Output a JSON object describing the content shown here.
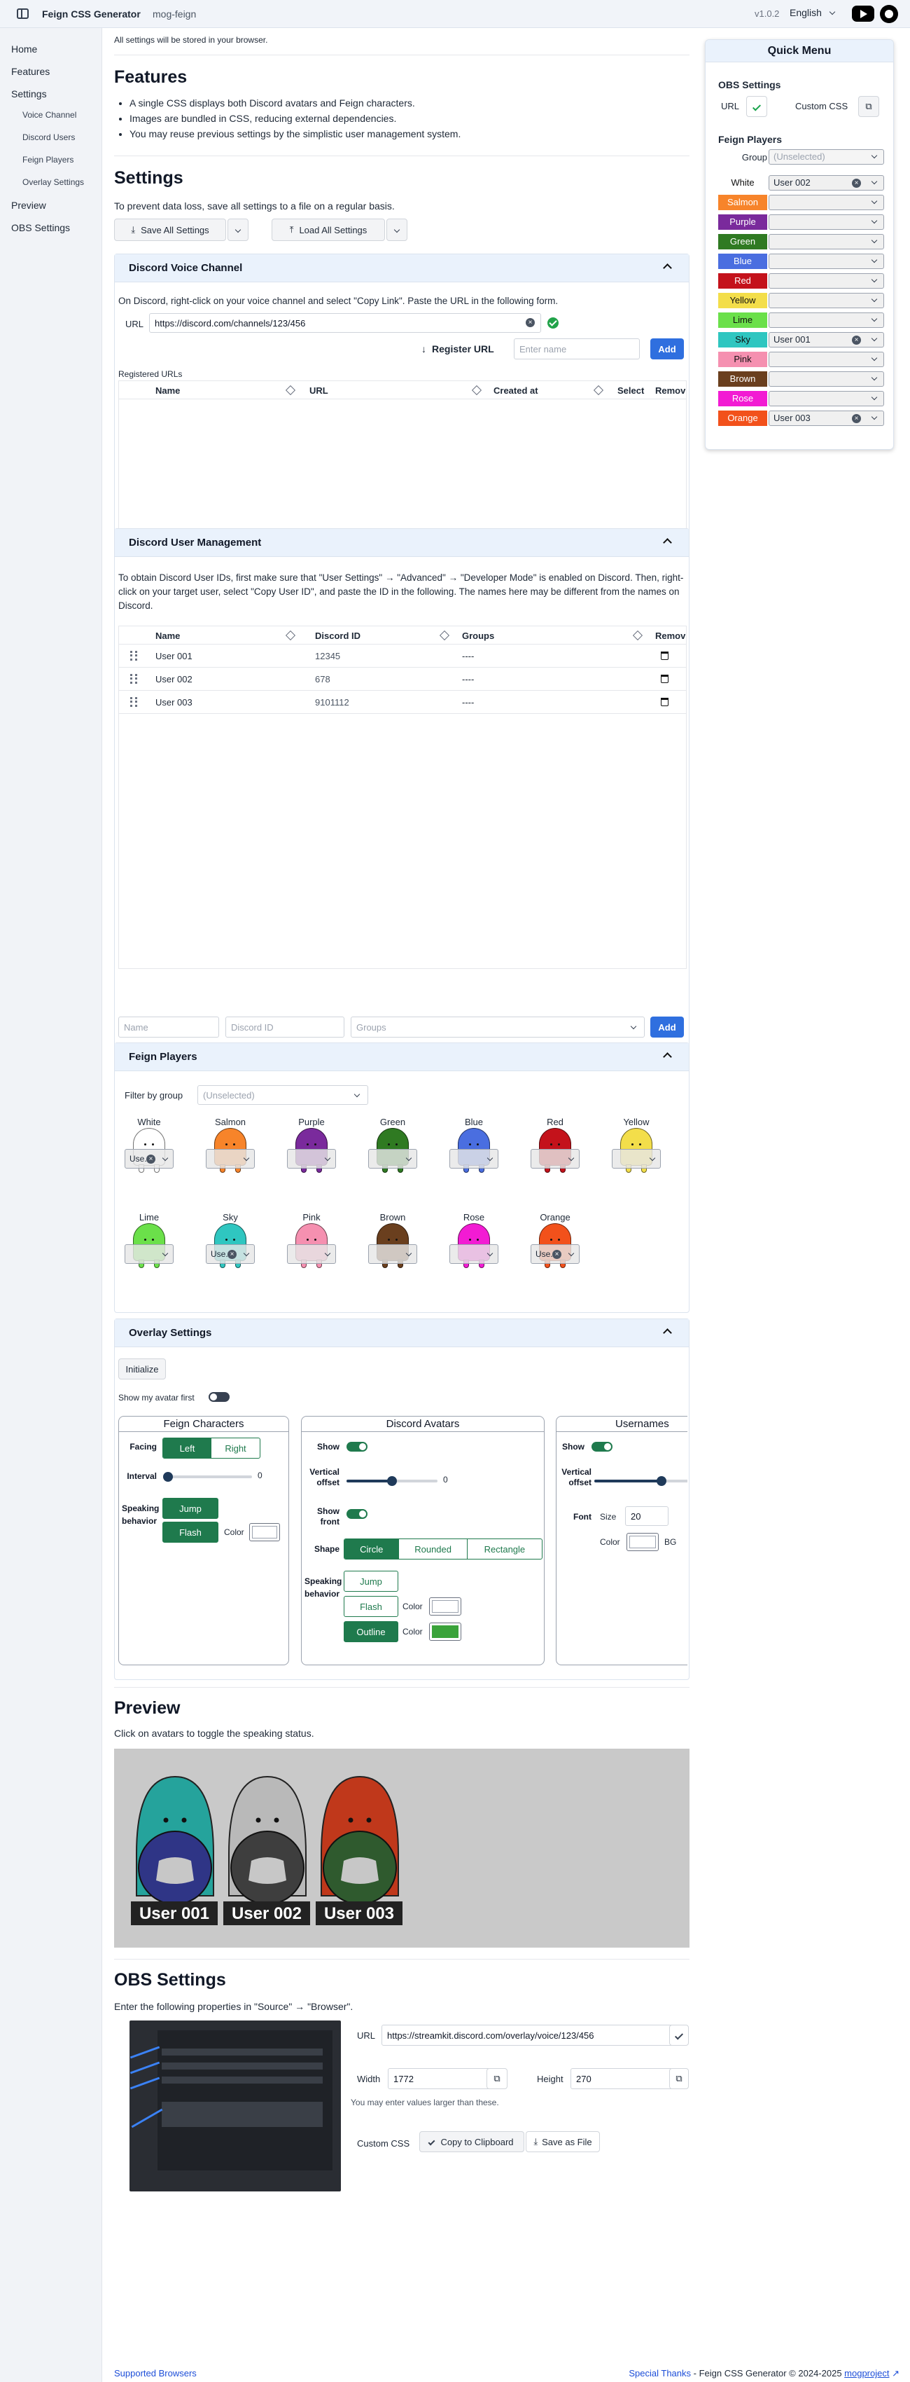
{
  "app": {
    "title": "Feign CSS Generator",
    "subtitle": "mog-feign",
    "version": "v1.0.2",
    "language": "English"
  },
  "sidebar": {
    "items": [
      {
        "label": "Home"
      },
      {
        "label": "Features"
      },
      {
        "label": "Settings"
      },
      {
        "label": "Voice Channel"
      },
      {
        "label": "Discord Users"
      },
      {
        "label": "Feign Players"
      },
      {
        "label": "Overlay Settings"
      },
      {
        "label": "Preview"
      },
      {
        "label": "OBS Settings"
      }
    ]
  },
  "notice": "All settings will be stored in your browser.",
  "features": {
    "heading": "Features",
    "bullets": [
      "A single CSS displays both Discord avatars and Feign characters.",
      "Images are bundled in CSS, reducing external dependencies.",
      "You may reuse previous settings by the simplistic user management system."
    ]
  },
  "settings": {
    "heading": "Settings",
    "desc": "To prevent data loss, save all settings to a file on a regular basis.",
    "save_all": "Save All Settings",
    "load_all": "Load All Settings"
  },
  "voice": {
    "title": "Discord Voice Channel",
    "desc": "On Discord, right-click on your voice channel and select \"Copy Link\". Paste the URL in the following form.",
    "url_label": "URL",
    "url_value": "https://discord.com/channels/123/456",
    "register": "Register URL",
    "name_placeholder": "Enter name",
    "add": "Add",
    "registered_label": "Registered URLs",
    "cols": [
      "Name",
      "URL",
      "Created at",
      "Select",
      "Remov"
    ]
  },
  "users": {
    "title": "Discord User Management",
    "desc": "To obtain Discord User IDs, first make sure that \"User Settings\" → \"Advanced\" → \"Developer Mode\" is enabled on Discord. Then, right-click on your target user, select \"Copy User ID\", and paste the ID in the following. The names here may be different from the names on Discord.",
    "cols": [
      "Name",
      "Discord ID",
      "Groups",
      "Remov"
    ],
    "rows": [
      {
        "name": "User 001",
        "id": "12345",
        "groups": "----"
      },
      {
        "name": "User 002",
        "id": "678",
        "groups": "----"
      },
      {
        "name": "User 003",
        "id": "9101112",
        "groups": "----"
      }
    ],
    "name_ph": "Name",
    "id_ph": "Discord ID",
    "groups_ph": "Groups",
    "add": "Add"
  },
  "players": {
    "title": "Feign Players",
    "filter_label": "Filter by group",
    "filter_value": "(Unselected)",
    "chars": [
      {
        "name": "White",
        "color": "#ffffff",
        "user": "Use..."
      },
      {
        "name": "Salmon",
        "color": "#f7842a",
        "user": ""
      },
      {
        "name": "Purple",
        "color": "#7a2a9c",
        "user": ""
      },
      {
        "name": "Green",
        "color": "#2f7a22",
        "user": ""
      },
      {
        "name": "Blue",
        "color": "#4a6ee0",
        "user": ""
      },
      {
        "name": "Red",
        "color": "#c4121b",
        "user": ""
      },
      {
        "name": "Yellow",
        "color": "#f3de4a",
        "user": ""
      },
      {
        "name": "Lime",
        "color": "#6be04a",
        "user": ""
      },
      {
        "name": "Sky",
        "color": "#2fc6c0",
        "user": "Use..."
      },
      {
        "name": "Pink",
        "color": "#f590b0",
        "user": ""
      },
      {
        "name": "Brown",
        "color": "#6a3f1e",
        "user": ""
      },
      {
        "name": "Rose",
        "color": "#f21bd3",
        "user": ""
      },
      {
        "name": "Orange",
        "color": "#f2511b",
        "user": "Use..."
      }
    ]
  },
  "overlay": {
    "title": "Overlay Settings",
    "initialize": "Initialize",
    "show_avatar_first": "Show my avatar first",
    "feign": {
      "title": "Feign Characters",
      "facing": "Facing",
      "left": "Left",
      "right": "Right",
      "interval": "Interval",
      "interval_value": "0",
      "interval_fraction": 0,
      "speaking": "Speaking behavior",
      "jump": "Jump",
      "flash": "Flash",
      "color": "Color"
    },
    "avatars": {
      "title": "Discord Avatars",
      "show": "Show",
      "vertical_offset": "Vertical offset",
      "offset_value": "0",
      "offset_fraction": 0.5,
      "show_front": "Show front",
      "shape": "Shape",
      "circle": "Circle",
      "rounded": "Rounded",
      "rectangle": "Rectangle",
      "speaking": "Speaking behavior",
      "jump": "Jump",
      "flash": "Flash",
      "outline": "Outline",
      "color": "Color",
      "outline_color": "#3aa33a"
    },
    "usernames": {
      "title": "Usernames",
      "show": "Show",
      "vertical_offset": "Vertical offset",
      "offset_fraction": 0.6,
      "font": "Font",
      "size": "Size",
      "size_value": "20",
      "color": "Color",
      "bg": "BG"
    }
  },
  "preview": {
    "heading": "Preview",
    "desc": "Click on avatars to toggle the speaking status.",
    "users": [
      {
        "name": "User 001",
        "char": "#25a39c",
        "disc": "#2f3586"
      },
      {
        "name": "User 002",
        "char": "#b9b9b9",
        "disc": "#3e3e3e"
      },
      {
        "name": "User 003",
        "char": "#c0381b",
        "disc": "#2f5a2e"
      }
    ]
  },
  "obs": {
    "heading": "OBS Settings",
    "desc": "Enter the following properties in \"Source\" → \"Browser\".",
    "url_label": "URL",
    "url_value": "https://streamkit.discord.com/overlay/voice/123/456",
    "width_label": "Width",
    "width_value": "1772",
    "height_label": "Height",
    "height_value": "270",
    "hint": "You may enter values larger than these.",
    "css_label": "Custom CSS",
    "copy": "Copy to Clipboard",
    "save": "Save as File"
  },
  "quick_menu": {
    "title": "Quick Menu",
    "obs_label": "OBS Settings",
    "url": "URL",
    "custom_css": "Custom CSS",
    "players_label": "Feign Players",
    "group": "Group",
    "group_value": "(Unselected)",
    "rows": [
      {
        "name": "White",
        "color": "#ffffff",
        "value": "User 002"
      },
      {
        "name": "Salmon",
        "color": "#f7842a",
        "value": ""
      },
      {
        "name": "Purple",
        "color": "#7a2a9c",
        "value": ""
      },
      {
        "name": "Green",
        "color": "#2f7a22",
        "value": ""
      },
      {
        "name": "Blue",
        "color": "#4a6ee0",
        "value": ""
      },
      {
        "name": "Red",
        "color": "#c4121b",
        "value": ""
      },
      {
        "name": "Yellow",
        "color": "#f3de4a",
        "value": ""
      },
      {
        "name": "Lime",
        "color": "#6be04a",
        "value": ""
      },
      {
        "name": "Sky",
        "color": "#2fc6c0",
        "value": "User 001"
      },
      {
        "name": "Pink",
        "color": "#f590b0",
        "value": ""
      },
      {
        "name": "Brown",
        "color": "#6a3f1e",
        "value": ""
      },
      {
        "name": "Rose",
        "color": "#f21bd3",
        "value": ""
      },
      {
        "name": "Orange",
        "color": "#f2511b",
        "value": "User 003"
      }
    ]
  },
  "footer": {
    "supported": "Supported Browsers",
    "thanks": "Special Thanks",
    "copyright": " - Feign CSS Generator © 2024-2025 ",
    "author": "mogproject"
  }
}
